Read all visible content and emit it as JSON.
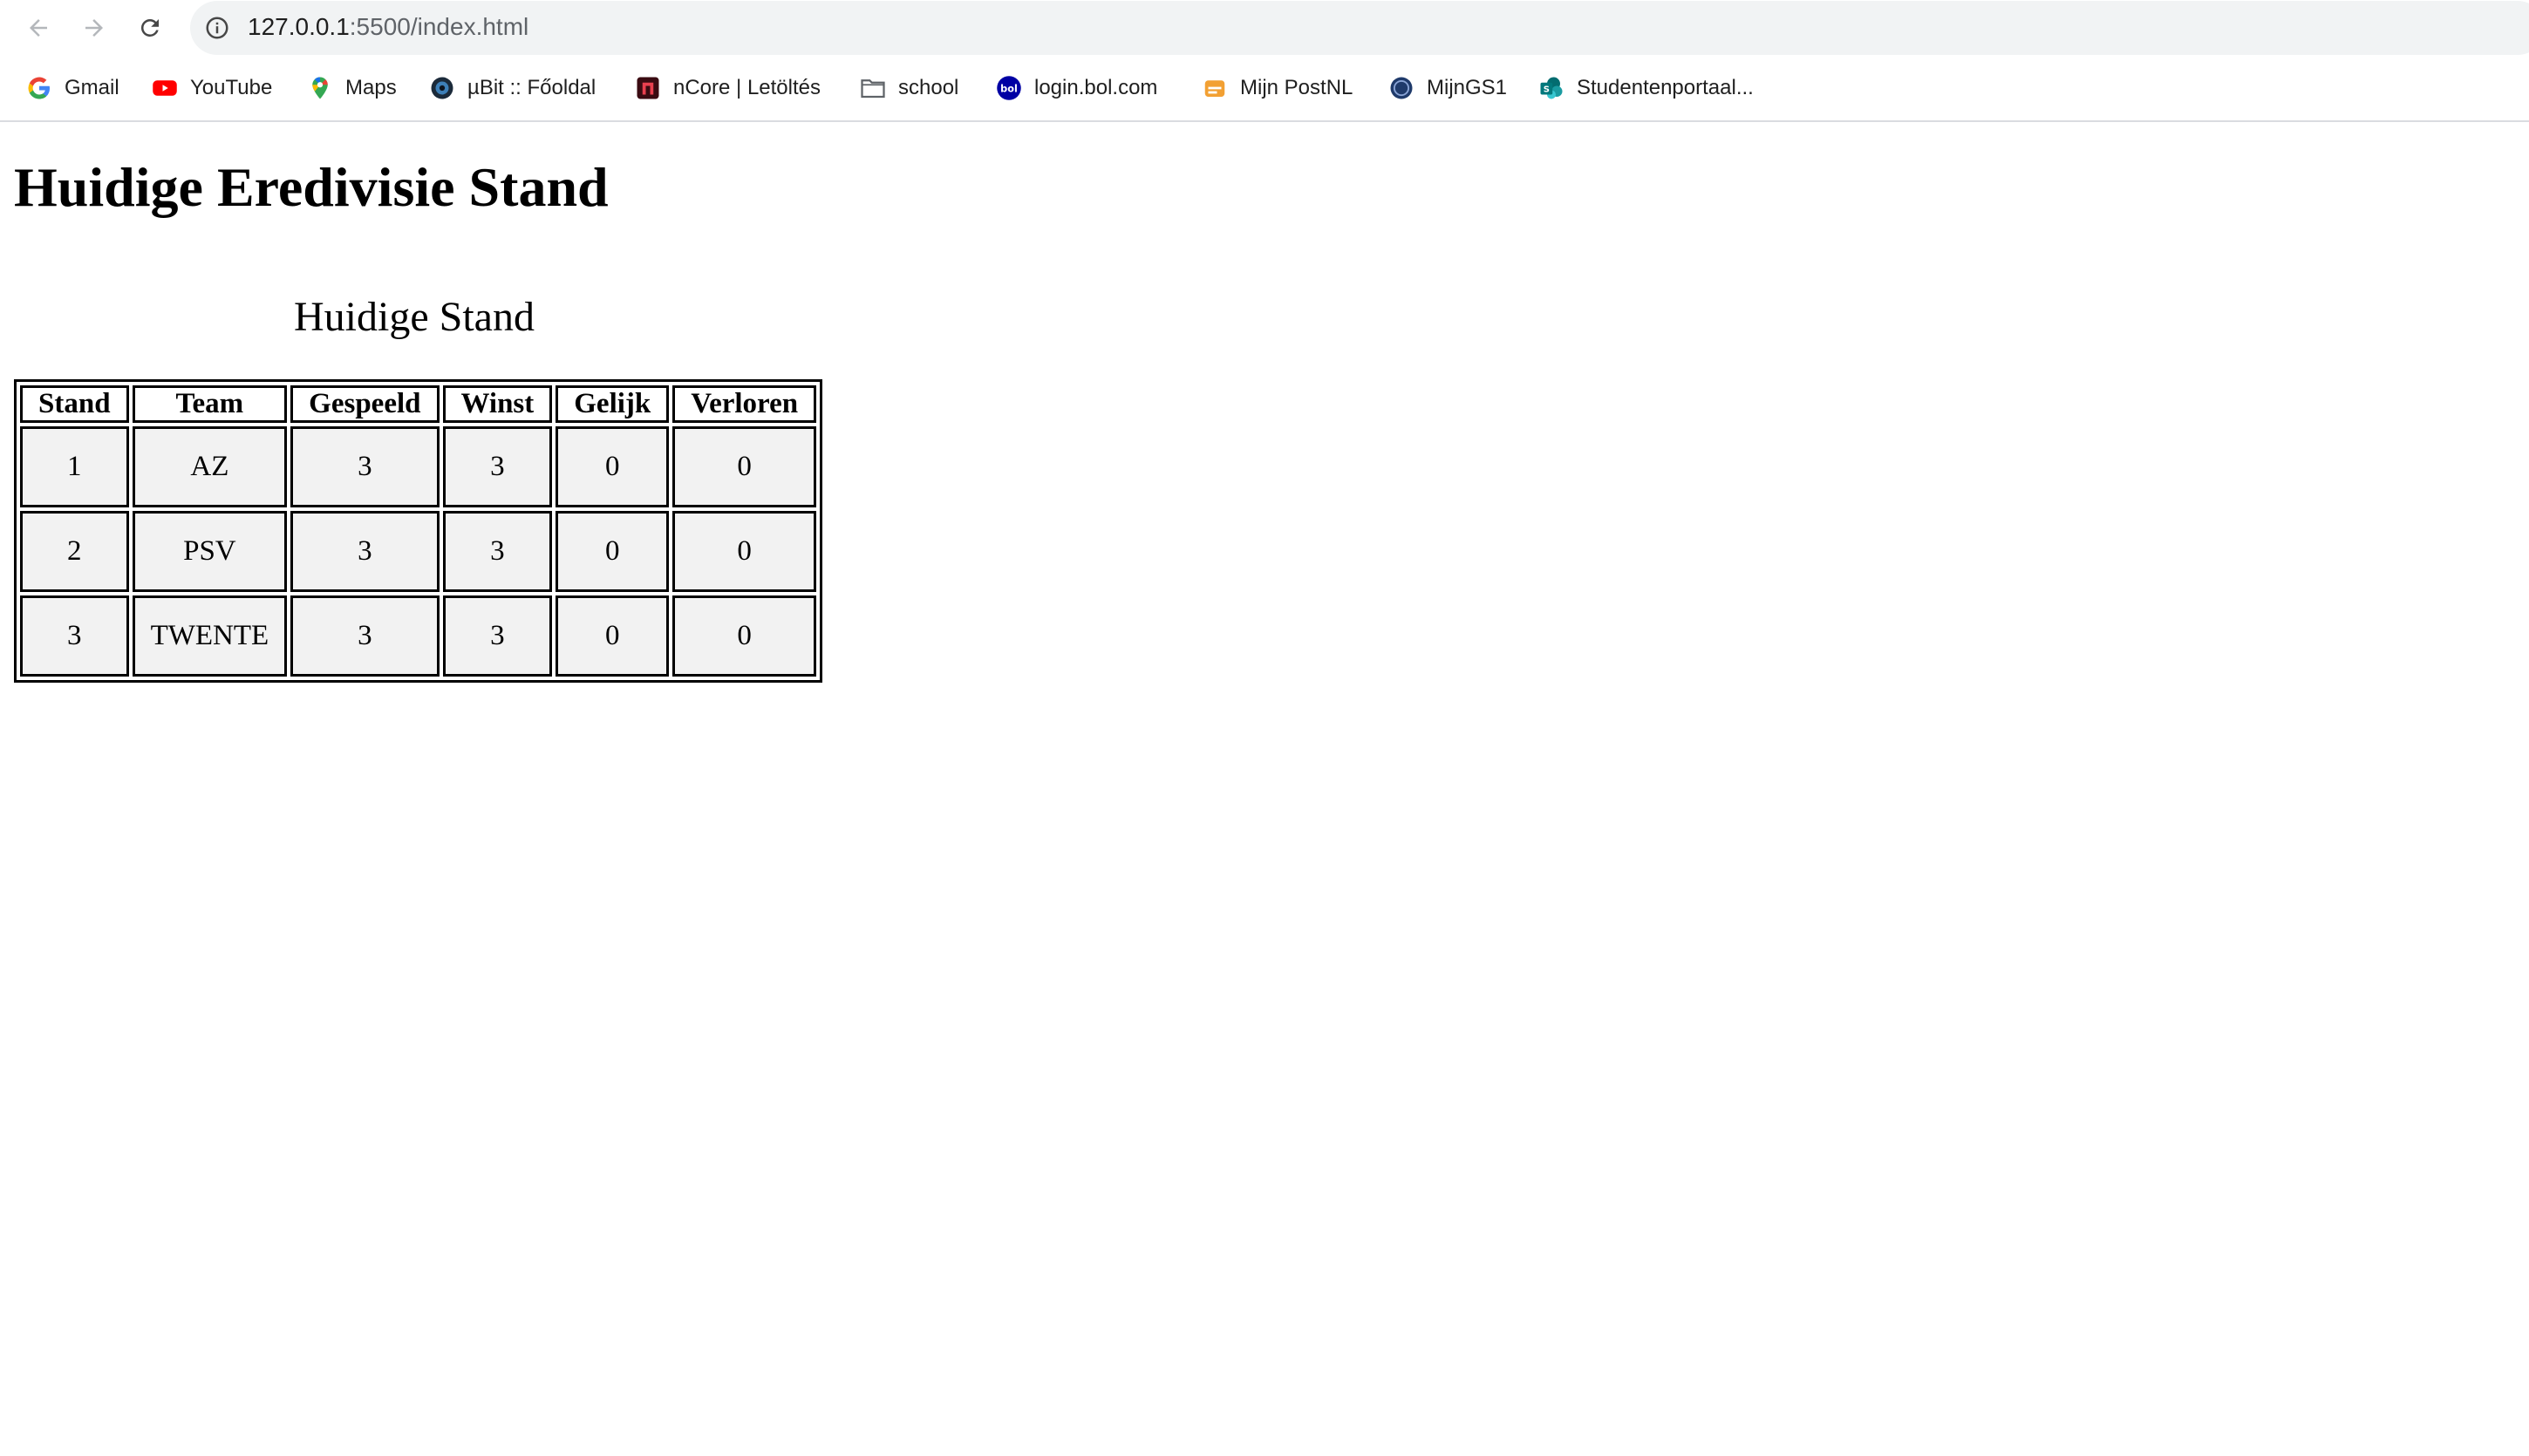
{
  "browser": {
    "url_host": "127.0.0.1",
    "url_rest": ":5500/index.html",
    "bookmarks": [
      {
        "label": "Gmail",
        "icon": "google-icon"
      },
      {
        "label": "YouTube",
        "icon": "youtube-icon"
      },
      {
        "label": "Maps",
        "icon": "maps-icon"
      },
      {
        "label": "µBit :: Főoldal",
        "icon": "ubit-icon"
      },
      {
        "label": "nCore | Letöltés",
        "icon": "ncore-icon"
      },
      {
        "label": "school",
        "icon": "folder-icon"
      },
      {
        "label": "login.bol.com",
        "icon": "bol-icon"
      },
      {
        "label": "Mijn PostNL",
        "icon": "postnl-icon"
      },
      {
        "label": "MijnGS1",
        "icon": "gs1-icon"
      },
      {
        "label": "Studentenportaal...",
        "icon": "sharepoint-icon"
      }
    ]
  },
  "page": {
    "heading": "Huidige Eredivisie Stand",
    "table": {
      "caption": "Huidige Stand",
      "headers": [
        "Stand",
        "Team",
        "Gespeeld",
        "Winst",
        "Gelijk",
        "Verloren"
      ],
      "rows": [
        [
          "1",
          "AZ",
          "3",
          "3",
          "0",
          "0"
        ],
        [
          "2",
          "PSV",
          "3",
          "3",
          "0",
          "0"
        ],
        [
          "3",
          "TWENTE",
          "3",
          "3",
          "0",
          "0"
        ]
      ]
    }
  }
}
